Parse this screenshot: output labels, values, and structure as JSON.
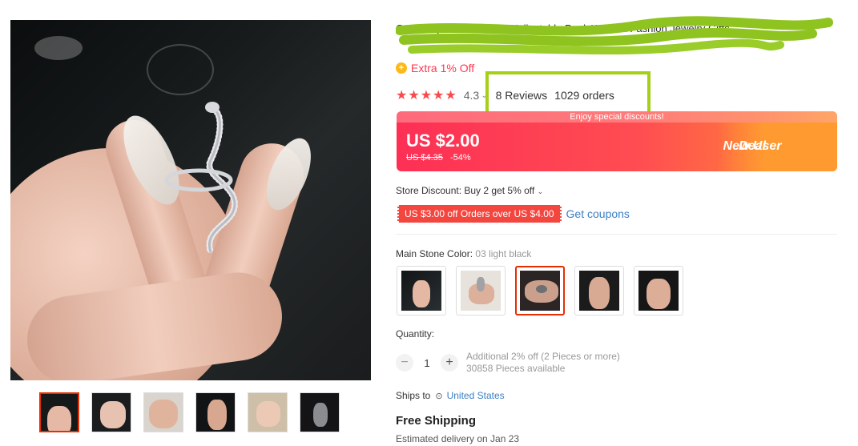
{
  "product": {
    "title": "Gothic Open Snake Ring Adjustable Punk Women Fashion Jewelry Gifts"
  },
  "promo": {
    "extra_off": "Extra 1% Off"
  },
  "rating": {
    "stars": "★★★★★",
    "value": "4.3",
    "reviews": "8 Reviews",
    "orders": "1029 orders"
  },
  "price": {
    "banner": "Enjoy special discounts!",
    "current": "US $2.00",
    "original": "US $4.35",
    "discount": "-54%",
    "deal_line1": "New User",
    "deal_line2": "Deal"
  },
  "store": {
    "discount_text": "Store Discount: Buy 2 get 5% off",
    "coupon": "US $3.00 off Orders over US $4.00",
    "get_coupons": "Get coupons"
  },
  "color": {
    "label": "Main Stone Color:",
    "selected": "03 light black"
  },
  "quantity": {
    "label": "Quantity:",
    "value": "1",
    "minus": "−",
    "plus": "+",
    "offer": "Additional 2% off (2 Pieces or more)",
    "available": "30858 Pieces available"
  },
  "shipping": {
    "ships_to": "Ships to",
    "country": "United States",
    "free": "Free Shipping",
    "delivery": "Estimated delivery on Jan 23"
  },
  "colors": {
    "accent": "#e62e04",
    "price_gradient_start": "#fd2f55",
    "price_gradient_end": "#ff9a31",
    "link": "#3a7fc4",
    "highlight": "#a6cf1a"
  },
  "icons": [
    "coin-icon",
    "chevron-down-icon",
    "location-pin-icon",
    "star-icon"
  ]
}
